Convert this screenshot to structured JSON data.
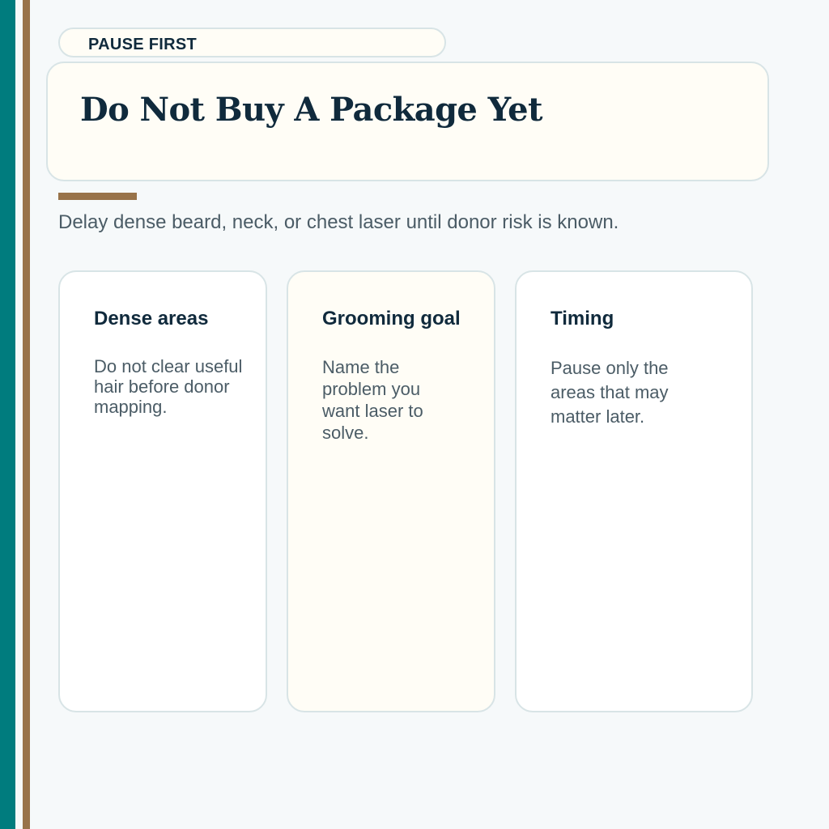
{
  "eyebrow": {
    "label": "PAUSE FIRST"
  },
  "title": "Do Not Buy A Package Yet",
  "subtitle": "Delay dense beard, neck, or chest laser until donor risk is known.",
  "cards": [
    {
      "title": "Dense areas",
      "body": "Do not clear useful hair before donor mapping."
    },
    {
      "title": "Grooming goal",
      "body": "Name the problem you want laser to solve."
    },
    {
      "title": "Timing",
      "body": "Pause only the areas that may matter later."
    }
  ],
  "colors": {
    "teal": "#007c7e",
    "brown_accent": "#98734a",
    "navy_text": "#102a3c",
    "body_text": "#4b5c66",
    "background": "#f6f9fa",
    "cream": "#fffdf6"
  }
}
